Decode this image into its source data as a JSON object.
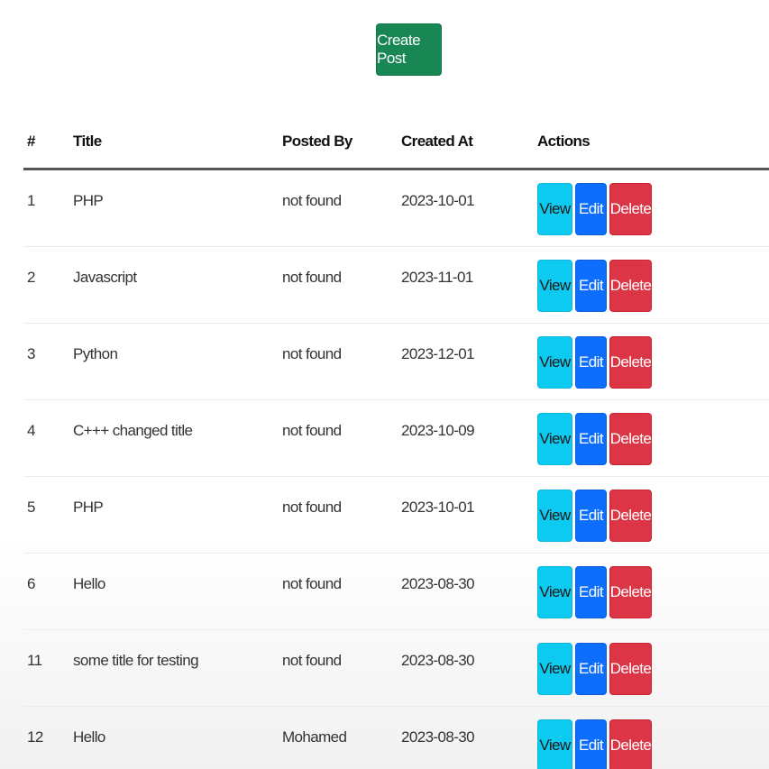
{
  "toolbar": {
    "create_label": "Create Post",
    "create_color": "#198754"
  },
  "table": {
    "headers": {
      "num": "#",
      "title": "Title",
      "posted_by": "Posted By",
      "created_at": "Created At",
      "actions": "Actions"
    },
    "action_labels": {
      "view": "View",
      "edit": "Edit",
      "delete": "Delete"
    },
    "action_colors": {
      "view": "#0dcaf0",
      "edit": "#0d6efd",
      "delete": "#dc3545"
    },
    "rows": [
      {
        "id": "1",
        "title": "PHP",
        "posted_by": "not found",
        "created_at": "2023-10-01"
      },
      {
        "id": "2",
        "title": "Javascript",
        "posted_by": "not found",
        "created_at": "2023-11-01"
      },
      {
        "id": "3",
        "title": "Python",
        "posted_by": "not found",
        "created_at": "2023-12-01"
      },
      {
        "id": "4",
        "title": "C+++ changed title",
        "posted_by": "not found",
        "created_at": "2023-10-09"
      },
      {
        "id": "5",
        "title": "PHP",
        "posted_by": "not found",
        "created_at": "2023-10-01"
      },
      {
        "id": "6",
        "title": "Hello",
        "posted_by": "not found",
        "created_at": "2023-08-30"
      },
      {
        "id": "11",
        "title": "some title for testing",
        "posted_by": "not found",
        "created_at": "2023-08-30"
      },
      {
        "id": "12",
        "title": "Hello",
        "posted_by": "Mohamed",
        "created_at": "2023-08-30"
      }
    ]
  }
}
